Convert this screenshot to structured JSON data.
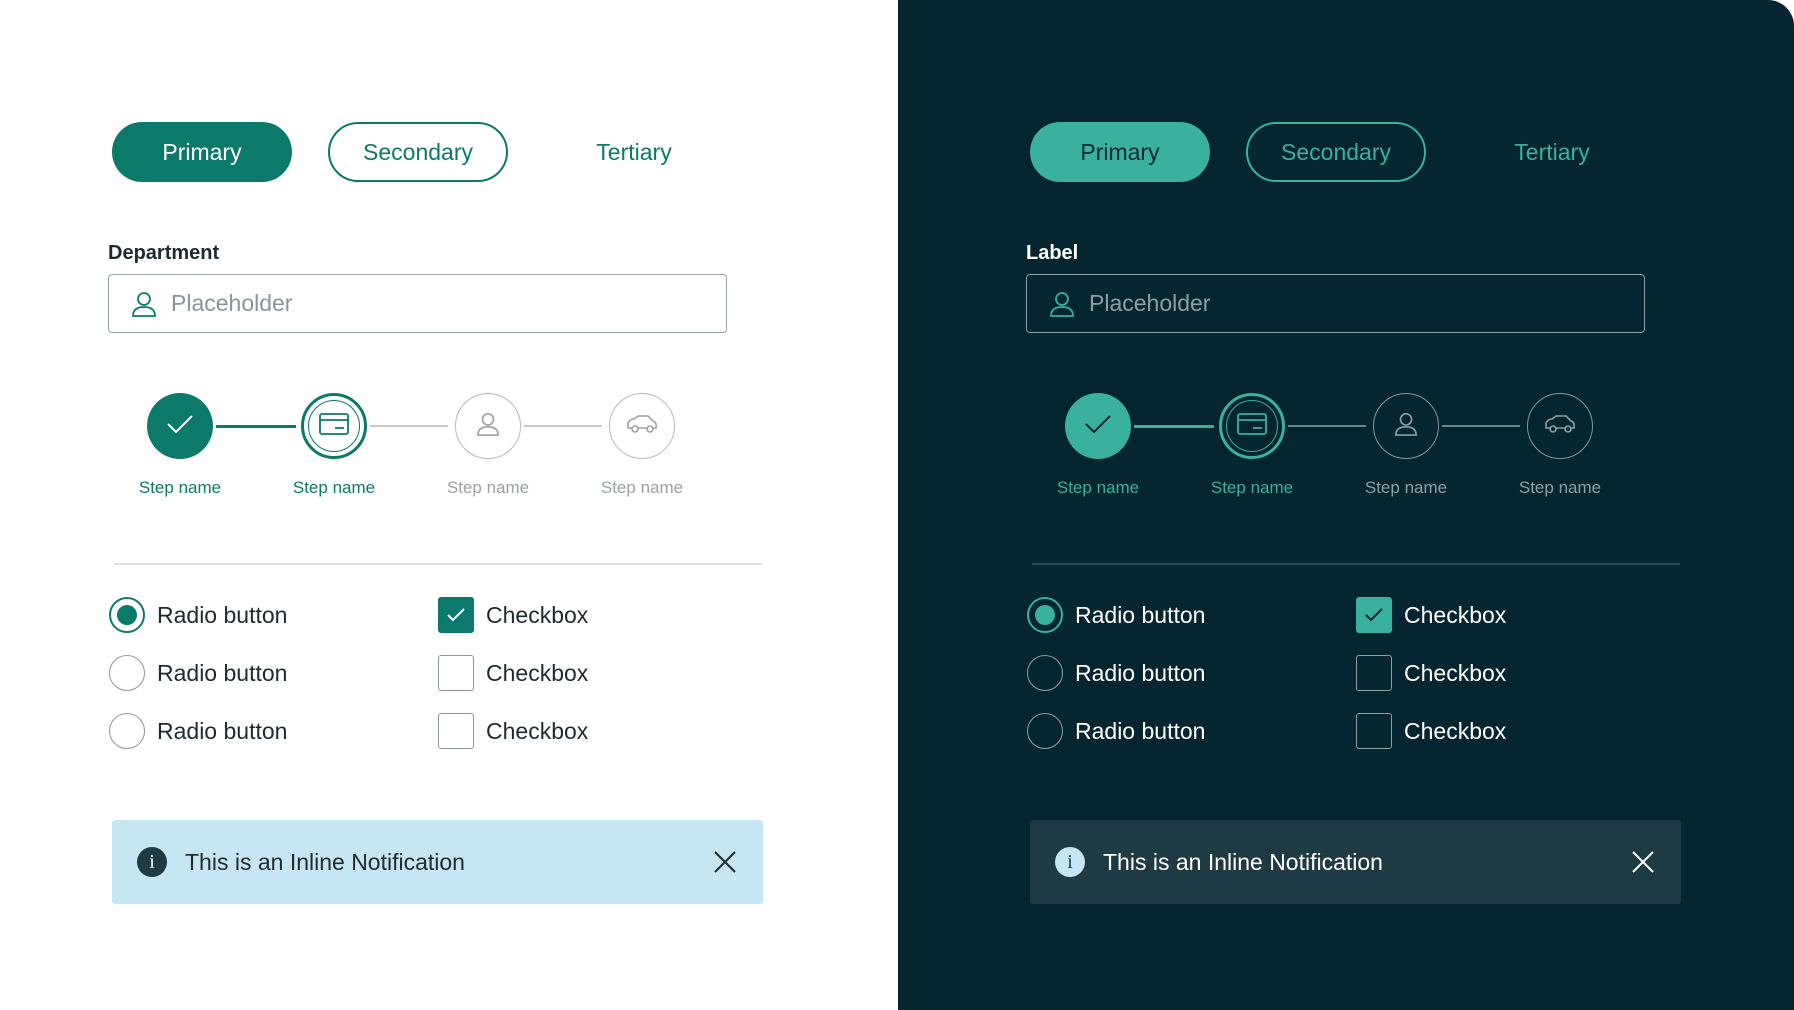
{
  "light": {
    "buttons": {
      "primary": "Primary",
      "secondary": "Secondary",
      "tertiary": "Tertiary"
    },
    "field": {
      "label": "Department",
      "placeholder": "Placeholder"
    },
    "steps": [
      {
        "label": "Step name",
        "state": "done"
      },
      {
        "label": "Step name",
        "state": "active"
      },
      {
        "label": "Step name",
        "state": "todo"
      },
      {
        "label": "Step name",
        "state": "todo"
      }
    ],
    "radios": [
      {
        "label": "Radio button",
        "selected": true
      },
      {
        "label": "Radio button",
        "selected": false
      },
      {
        "label": "Radio button",
        "selected": false
      }
    ],
    "checkboxes": [
      {
        "label": "Checkbox",
        "checked": true
      },
      {
        "label": "Checkbox",
        "checked": false
      },
      {
        "label": "Checkbox",
        "checked": false
      }
    ],
    "notification": {
      "text": "This is an Inline Notification",
      "icon": "info-icon"
    }
  },
  "dark": {
    "buttons": {
      "primary": "Primary",
      "secondary": "Secondary",
      "tertiary": "Tertiary"
    },
    "field": {
      "label": "Label",
      "placeholder": "Placeholder"
    },
    "steps": [
      {
        "label": "Step name",
        "state": "done"
      },
      {
        "label": "Step name",
        "state": "active"
      },
      {
        "label": "Step name",
        "state": "todo"
      },
      {
        "label": "Step name",
        "state": "todo"
      }
    ],
    "radios": [
      {
        "label": "Radio button",
        "selected": true
      },
      {
        "label": "Radio button",
        "selected": false
      },
      {
        "label": "Radio button",
        "selected": false
      }
    ],
    "checkboxes": [
      {
        "label": "Checkbox",
        "checked": true
      },
      {
        "label": "Checkbox",
        "checked": false
      },
      {
        "label": "Checkbox",
        "checked": false
      }
    ],
    "notification": {
      "text": "This is an Inline Notification",
      "icon": "info-icon"
    }
  },
  "colors": {
    "light_accent": "#0b7a6b",
    "dark_accent": "#39b0a0",
    "dark_background": "#052530",
    "light_notification_bg": "#c6e6f4",
    "dark_notification_bg": "#1e3b45"
  }
}
